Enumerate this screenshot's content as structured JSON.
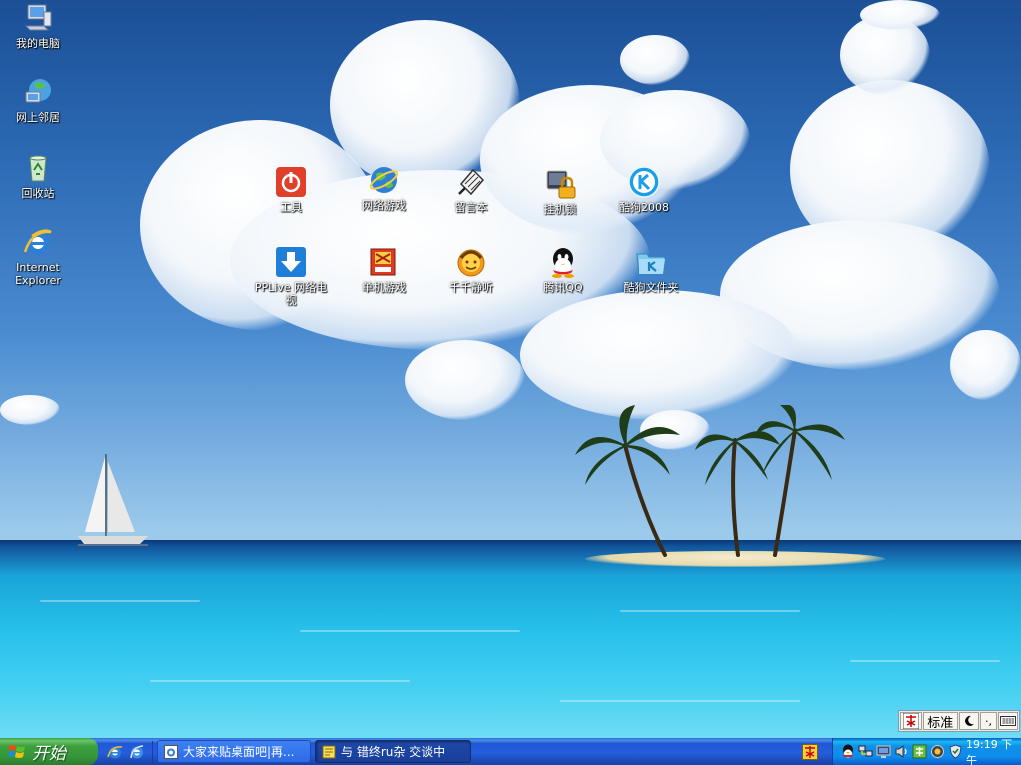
{
  "desktop": {
    "left_icons": [
      {
        "label": "我的电脑",
        "icon": "my-computer-icon"
      },
      {
        "label": "网上邻居",
        "icon": "network-places-icon"
      },
      {
        "label": "回收站",
        "icon": "recycle-bin-icon"
      },
      {
        "label": "Internet Explorer",
        "icon": "internet-explorer-icon"
      }
    ],
    "grid_icons": [
      {
        "label": "工具",
        "icon": "tools-power-icon"
      },
      {
        "label": "网络游戏",
        "icon": "online-games-globe-icon"
      },
      {
        "label": "留言本",
        "icon": "guestbook-icon"
      },
      {
        "label": "挂机锁",
        "icon": "lock-icon"
      },
      {
        "label": "酷狗2008",
        "icon": "kugou-icon"
      },
      {
        "label": "PPLive 网络电视",
        "icon": "pplive-download-icon"
      },
      {
        "label": "单机游戏",
        "icon": "single-games-icon"
      },
      {
        "label": "千千静听",
        "icon": "ttplayer-icon"
      },
      {
        "label": "腾讯QQ",
        "icon": "qq-penguin-icon"
      },
      {
        "label": "酷狗文件夹",
        "icon": "kugou-folder-icon"
      }
    ]
  },
  "ime": {
    "mode": "标准",
    "segments": [
      "moon-icon",
      "punctuation-icon",
      "soft-keyboard-icon"
    ],
    "punct": "·,"
  },
  "taskbar": {
    "start_label": "开始",
    "quick_launch": [
      "ie-quick-icon",
      "ie-quick-icon-2"
    ],
    "tasks": [
      {
        "label": "大家来贴桌面吧|再...",
        "active": false
      },
      {
        "label": "与 错终ru杂 交谈中",
        "active": true
      }
    ],
    "tray_icons": [
      "qq-tray-icon",
      "network-tray-icon",
      "display-tray-icon",
      "volume-tray-icon",
      "ime-tray-icon",
      "safety-tray-icon",
      "shield-tray-icon"
    ],
    "clock": "19:19 下午"
  },
  "colors": {
    "taskbar_blue": "#245edb",
    "start_green": "#3c9f3c",
    "tray_blue": "#0d8dea"
  }
}
